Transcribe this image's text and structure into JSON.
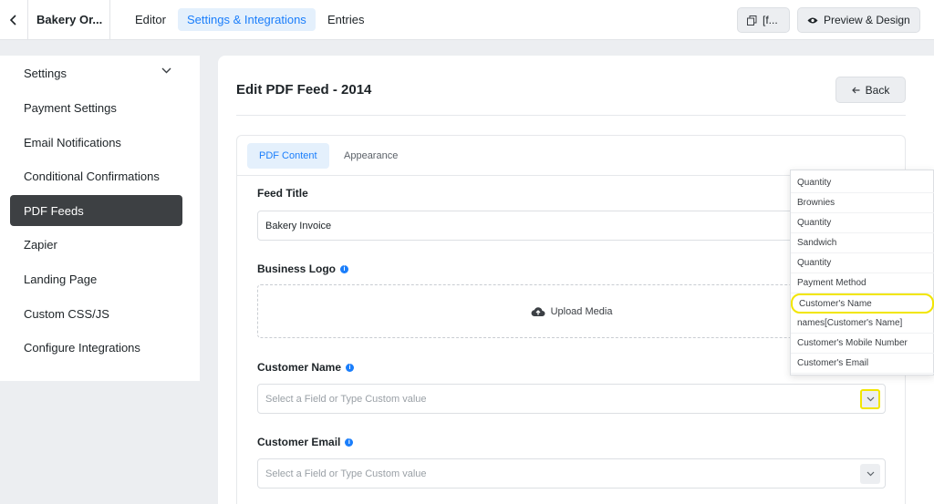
{
  "topbar": {
    "form_title": "Bakery Or...",
    "tabs": [
      {
        "label": "Editor"
      },
      {
        "label": "Settings & Integrations"
      },
      {
        "label": "Entries"
      }
    ],
    "shortcode_label": "[f...",
    "preview_label": "Preview & Design"
  },
  "sidebar": {
    "items": [
      {
        "label": "Settings"
      },
      {
        "label": "Payment Settings"
      },
      {
        "label": "Email Notifications"
      },
      {
        "label": "Conditional Confirmations"
      },
      {
        "label": "PDF Feeds"
      },
      {
        "label": "Zapier"
      },
      {
        "label": "Landing Page"
      },
      {
        "label": "Custom CSS/JS"
      },
      {
        "label": "Configure Integrations"
      }
    ]
  },
  "main": {
    "title": "Edit PDF Feed - 2014",
    "back_label": "Back",
    "tabs": [
      {
        "label": "PDF Content"
      },
      {
        "label": "Appearance"
      }
    ],
    "feed_title_label": "Feed Title",
    "feed_title_value": "Bakery Invoice",
    "business_logo_label": "Business Logo",
    "upload_label": "Upload Media",
    "customer_name_label": "Customer Name",
    "customer_name_placeholder": "Select a Field or Type Custom value",
    "customer_email_label": "Customer Email",
    "customer_email_placeholder": "Select a Field or Type Custom value"
  },
  "dropdown": {
    "options": [
      {
        "label": "Quantity"
      },
      {
        "label": "Brownies"
      },
      {
        "label": "Quantity"
      },
      {
        "label": "Sandwich"
      },
      {
        "label": "Quantity"
      },
      {
        "label": "Payment Method"
      },
      {
        "label": "Customer's Name"
      },
      {
        "label": "names[Customer's Name]"
      },
      {
        "label": "Customer's Mobile Number"
      },
      {
        "label": "Customer's Email"
      }
    ]
  },
  "colors": {
    "accent": "#1a7efb",
    "active_sidebar": "#3d4043",
    "highlight": "#f2e600"
  }
}
